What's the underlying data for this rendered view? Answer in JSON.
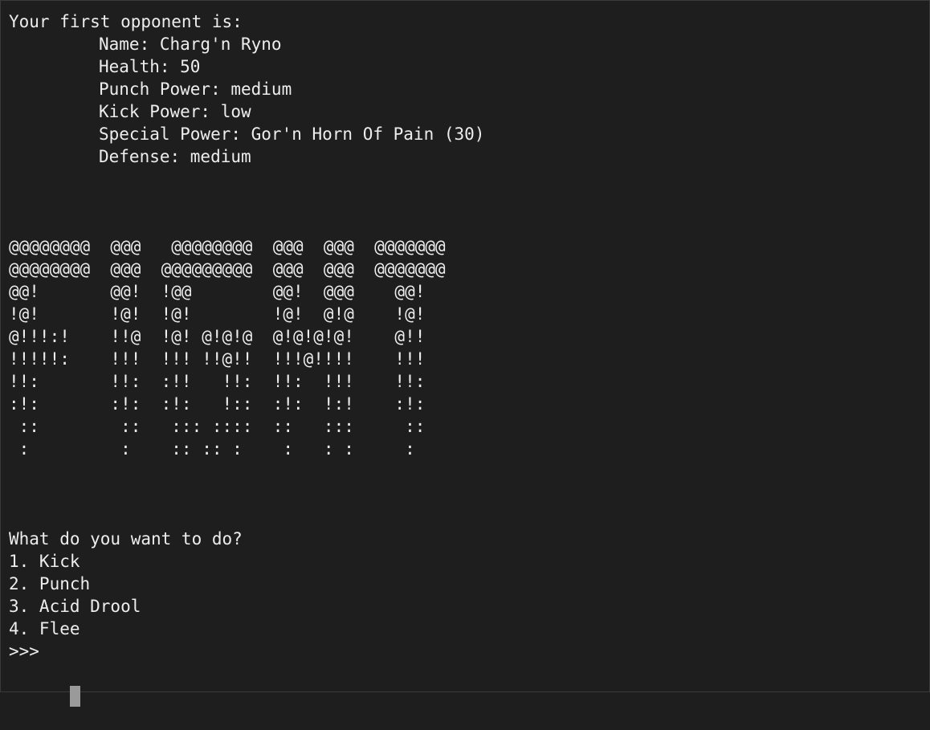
{
  "intro": "Your first opponent is:",
  "stats": [
    "Name: Charg'n Ryno",
    "Health: 50",
    "Punch Power: medium",
    "Kick Power: low",
    "Special Power: Gor'n Horn Of Pain (30)",
    "Defense: medium"
  ],
  "banner": [
    "@@@@@@@@  @@@   @@@@@@@@  @@@  @@@  @@@@@@@",
    "@@@@@@@@  @@@  @@@@@@@@@  @@@  @@@  @@@@@@@",
    "@@!       @@!  !@@        @@!  @@@    @@!",
    "!@!       !@!  !@!        !@!  @!@    !@!",
    "@!!!:!    !!@  !@! @!@!@  @!@!@!@!    @!!",
    "!!!!!:    !!!  !!! !!@!!  !!!@!!!!    !!!",
    "!!:       !!:  :!!   !!:  !!:  !!!    !!:",
    ":!:       :!:  :!:   !::  :!:  !:!    :!:",
    " ::        ::   ::: ::::  ::   :::     ::",
    " :         :    :: :: :    :   : :     :"
  ],
  "prompt": "What do you want to do?",
  "options": [
    "1. Kick",
    "2. Punch",
    "3. Acid Drool",
    "4. Flee"
  ],
  "input_prompt": ">>>"
}
